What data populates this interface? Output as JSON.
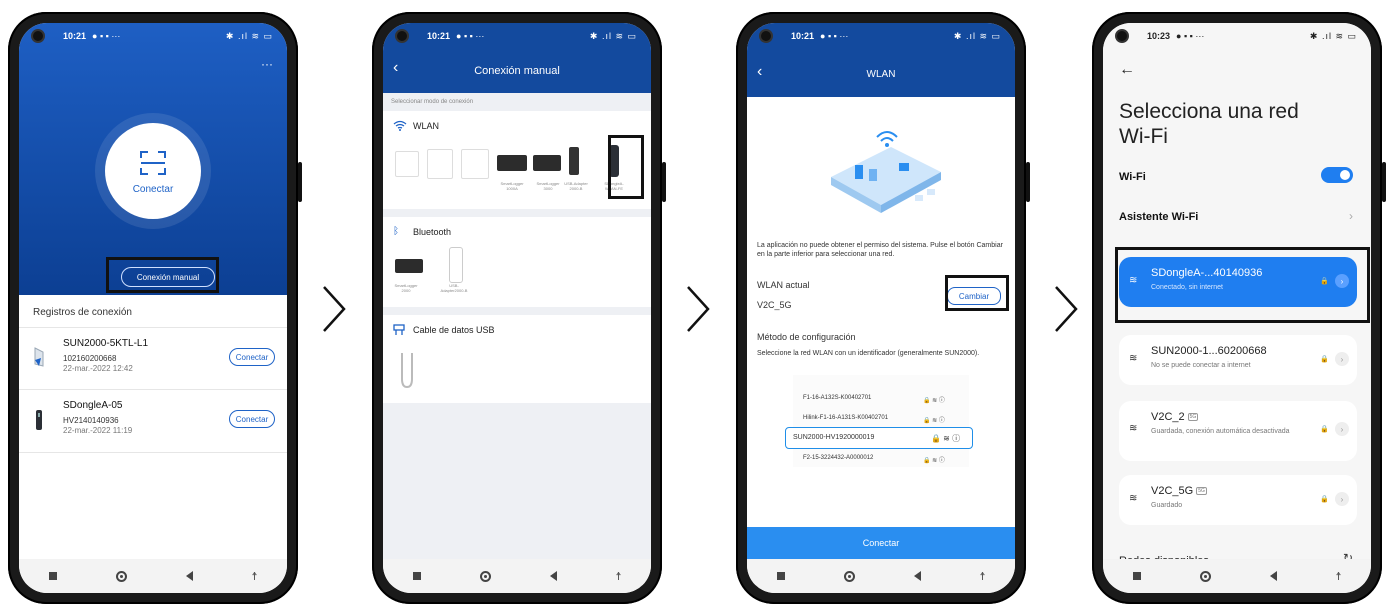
{
  "status": {
    "time_a": "10:21",
    "time_b": "10:23",
    "left_icons": "● ▪ ▪ ···",
    "right_icons": "✱ .ıl ≋ ▭"
  },
  "screen1": {
    "menu": "···",
    "connect_label": "Conectar",
    "manual_label": "Conexión manual",
    "records_title": "Registros de conexión",
    "records": [
      {
        "name": "SUN2000-5KTL-L1",
        "sn": "102160200668",
        "date": "22-mar.-2022 12:42",
        "button": "Conectar"
      },
      {
        "name": "SDongleA-05",
        "sn": "HV2140140936",
        "date": "22-mar.-2022 11:19",
        "button": "Conectar"
      }
    ]
  },
  "screen2": {
    "back": "‹",
    "title": "Conexión manual",
    "hint": "Seleccionar modo de conexión",
    "wlan": "WLAN",
    "bluetooth": "Bluetooth",
    "usb": "Cable de datos USB",
    "wlan_devices": [
      "SmartLogger 1000A",
      "SmartLogger 3000",
      "USB-Adapter 2000-B",
      "SDongleA-WLAN-FE"
    ],
    "bt_devices": [
      "SmartLogger 2000",
      "USB-Adapter2000-B"
    ]
  },
  "screen3": {
    "back": "‹",
    "title": "WLAN",
    "permission": "La aplicación no puede obtener el permiso del sistema. Pulse el botón Cambiar en la parte inferior para seleccionar una red.",
    "current_label": "WLAN actual",
    "current_value": "V2C_5G",
    "change_button": "Cambiar",
    "method_label": "Método de configuración",
    "method_text": "Seleccione la red WLAN con un identificador (generalmente SUN2000).",
    "networks": [
      "F1-16-A132S-K00402701",
      "Hilink-F1-16-A131S-K00402701",
      "SUN2000-HV1920000019",
      "F2-15-3224432-A0000012"
    ],
    "connect_button": "Conectar"
  },
  "screen4": {
    "back": "←",
    "title_line1": "Selecciona una red",
    "title_line2": "Wi-Fi",
    "wifi_label": "Wi-Fi",
    "assistant_label": "Asistente Wi-Fi",
    "chevron": "›",
    "cards": [
      {
        "name": "SDongleA-...40140936",
        "status": "Conectado, sin internet",
        "badge": ""
      },
      {
        "name": "SUN2000-1...60200668",
        "status": "No se puede conectar a internet",
        "badge": ""
      },
      {
        "name": "V2C_2",
        "status": "Guardada, conexión automática desactivada",
        "badge": "5G"
      },
      {
        "name": "V2C_5G",
        "status": "Guardado",
        "badge": "5G"
      }
    ],
    "available": "Redes disponibles"
  },
  "colors": {
    "primary": "#1f63c7",
    "header_blue": "#134a9e",
    "wifi_active": "#1f7ef0",
    "connect_bar": "#2a8ef0"
  }
}
